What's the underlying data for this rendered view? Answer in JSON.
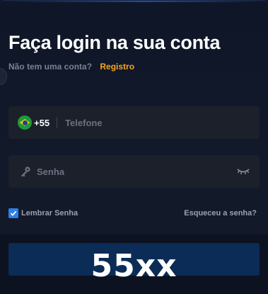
{
  "login": {
    "title": "Faça login na sua conta",
    "signup_question": "Não tem uma conta?",
    "signup_link": "Registro",
    "phone": {
      "country_flag": "brazil-flag-icon",
      "dial_code": "+55",
      "placeholder": "Telefone",
      "value": ""
    },
    "password": {
      "icon": "key-icon",
      "placeholder": "Senha",
      "value": "",
      "toggle_icon": "eye-closed-icon"
    },
    "remember_label": "Lembrar Senha",
    "remember_checked": true,
    "forgot_link": "Esqueceu a senha?",
    "submit_label": ""
  },
  "watermark": "55xx",
  "colors": {
    "background": "#0f1628",
    "field": "#1b202b",
    "accent_link": "#f5a623",
    "checkbox": "#2f7fe8",
    "submit": "#0b2c57"
  }
}
